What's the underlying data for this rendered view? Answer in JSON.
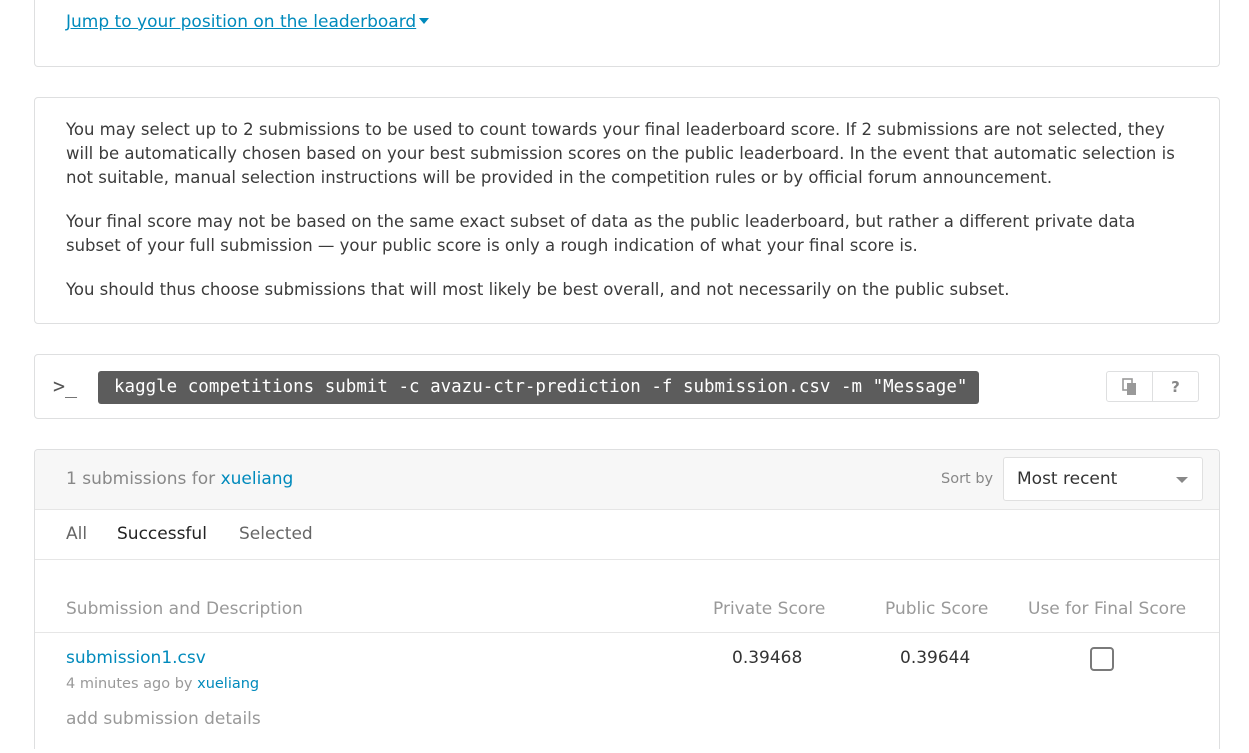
{
  "top": {
    "jump_link": "Jump to your position on the leaderboard"
  },
  "info": {
    "p1": "You may select up to 2 submissions to be used to count towards your final leaderboard score. If 2 submissions are not selected, they will be automatically chosen based on your best submission scores on the public leaderboard. In the event that automatic selection is not suitable, manual selection instructions will be provided in the competition rules or by official forum announcement.",
    "p2": "Your final score may not be based on the same exact subset of data as the public leaderboard, but rather a different private data subset of your full submission — your public score is only a rough indication of what your final score is.",
    "p3": "You should thus choose submissions that will most likely be best overall, and not necessarily on the public subset."
  },
  "cli": {
    "prompt": ">_",
    "command": "kaggle competitions submit -c avazu-ctr-prediction -f submission.csv -m \"Message\"",
    "help_label": "?"
  },
  "submissions": {
    "count_text": "1 submissions for",
    "user": "xueliang",
    "sort_label": "Sort by",
    "sort_value": "Most recent",
    "tabs": [
      "All",
      "Successful",
      "Selected"
    ],
    "active_tab": "Successful",
    "columns": {
      "description": "Submission and Description",
      "private": "Private Score",
      "public": "Public Score",
      "final": "Use for Final Score"
    },
    "rows": [
      {
        "file": "submission1.csv",
        "meta_prefix": "4 minutes ago by",
        "meta_user": "xueliang",
        "details_link": "add submission details",
        "private_score": "0.39468",
        "public_score": "0.39644",
        "use_for_final": false
      }
    ]
  },
  "colors": {
    "link": "#008abc",
    "accent_line": "#4caf50",
    "cli_bg": "#5c5c5c"
  }
}
